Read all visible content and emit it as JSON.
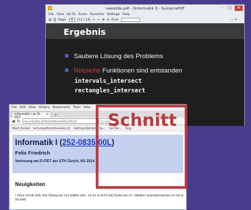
{
  "pdf_window": {
    "title": "newslide.pdf - [Informatik I] - SumatraPDF",
    "menu": [
      "File",
      "View",
      "Go To",
      "Zoom",
      "Favorites",
      "Settings",
      "Help"
    ],
    "toolbar": {
      "page_label": "Page:",
      "page_value": "9",
      "page_total": "(13 / 13)",
      "find_label": "Find:"
    },
    "slide": {
      "title": "Ergebnis",
      "bullet1": "Saubere Lösung des Problems",
      "bullet2_highlight": "Nützliche",
      "bullet2_rest": " Funktionen sind entstanden",
      "code1": "intervals_intersect",
      "code2": "rectangles_intersect"
    }
  },
  "browser_window": {
    "menu": [
      "File",
      "Edit",
      "View",
      "History",
      "Bookmarks",
      "Tools",
      "Help"
    ],
    "tab_title": "Informatik I an D-ITET",
    "url": "lec.inf.ethz.ch/itet/informatik1/2014/",
    "search_placeholder": "Google",
    "bookmarks": [
      "Most Visited",
      "lecturepdfs/admin/wiki.ch",
      "Getting Started",
      "Ap...",
      "SuI Pas...",
      "Eng..."
    ],
    "page": {
      "heading_prefix": "Informatik I (",
      "course_code": "252-0835-00L",
      "heading_suffix": ")",
      "author": "Felix Friedrich",
      "course_info": "Vorlesung am D-ITET der ETH Zürich, HS 2014",
      "news_title": "Neuigkeiten",
      "news_item": "2014-10-06 (fof): Die Übung bei Urs Müller (Mo. 13-15 im ETZ E6) findet am 27. Oktober ausnahmsweise im HG E 23 statt."
    }
  },
  "annotation": {
    "label": "Schnitt",
    "color": "#b43237"
  }
}
